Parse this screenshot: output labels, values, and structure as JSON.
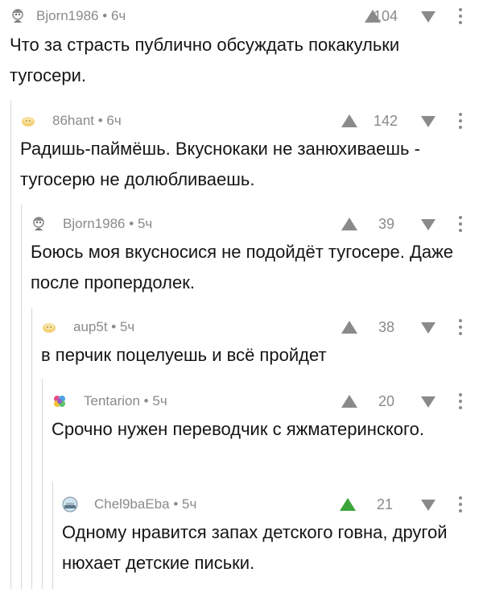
{
  "comments": [
    {
      "username": "Bjorn1986",
      "time": "6ч",
      "rating": "104",
      "text": "Что за страсть публично обсуждать покакульки тугосери.",
      "avatar_icon": "cartoon-avatar-icon",
      "upvoted": false
    },
    {
      "username": "86hant",
      "time": "6ч",
      "rating": "142",
      "text": "Радишь-паймёшь. Вкуснокаки не занюхиваешь - тугосерю не долюбливаешь.",
      "avatar_icon": "pikabu-default-avatar-icon",
      "upvoted": false
    },
    {
      "username": "Bjorn1986",
      "time": "5ч",
      "rating": "39",
      "text": "Боюсь моя вкусносися не подойдёт тугосере. Даже после пропердолек.",
      "avatar_icon": "cartoon-avatar-icon",
      "upvoted": false
    },
    {
      "username": "aup5t",
      "time": "5ч",
      "rating": "38",
      "text": "в перчик поцелуешь и всё пройдет",
      "avatar_icon": "pikabu-default-avatar-icon",
      "upvoted": false
    },
    {
      "username": "Tentarion",
      "time": "5ч",
      "rating": "20",
      "text": "Срочно нужен переводчик с яжматеринского.",
      "avatar_icon": "colorful-brain-avatar-icon",
      "upvoted": false
    },
    {
      "username": "Chel9baEba",
      "time": "5ч",
      "rating": "21",
      "text": "Одному нравится запах детского говна, другой нюхает детские письки.",
      "avatar_icon": "landscape-avatar-icon",
      "upvoted": true
    }
  ],
  "separator": "•",
  "colors": {
    "meta_text": "#8a8a8a",
    "vote_neutral": "#8a8a8a",
    "vote_up_active": "#3ca63c",
    "thread_line": "#d7d7d7"
  }
}
